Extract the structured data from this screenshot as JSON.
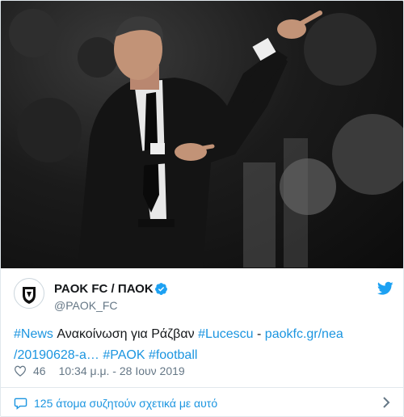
{
  "photo": {
    "icon": "football-manager-photo"
  },
  "account": {
    "display_name": "PAOK FC / ΠΑΟΚ",
    "handle": "@PAOK_FC",
    "verified": true,
    "avatar_icon": "paok-crest-icon"
  },
  "tweet": {
    "hashtag_news": "#News",
    "text_main": " Ανακοίνωση για Ράζβαν ",
    "hashtag_lucescu": "#Lucescu",
    "separator": " - ",
    "link_part1": "paokfc.gr/nea",
    "link_part2": "/20190628-a…",
    "hashtag_paok": "#PAOK",
    "hashtag_football": "#football"
  },
  "meta": {
    "likes": "46",
    "timestamp": "10:34 μ.μ. - 28 Ιουν 2019"
  },
  "footer": {
    "discussion": "125 άτομα συζητούν σχετικά με αυτό"
  },
  "colors": {
    "link": "#1b95e0",
    "text": "#14171a",
    "muted": "#657786"
  }
}
